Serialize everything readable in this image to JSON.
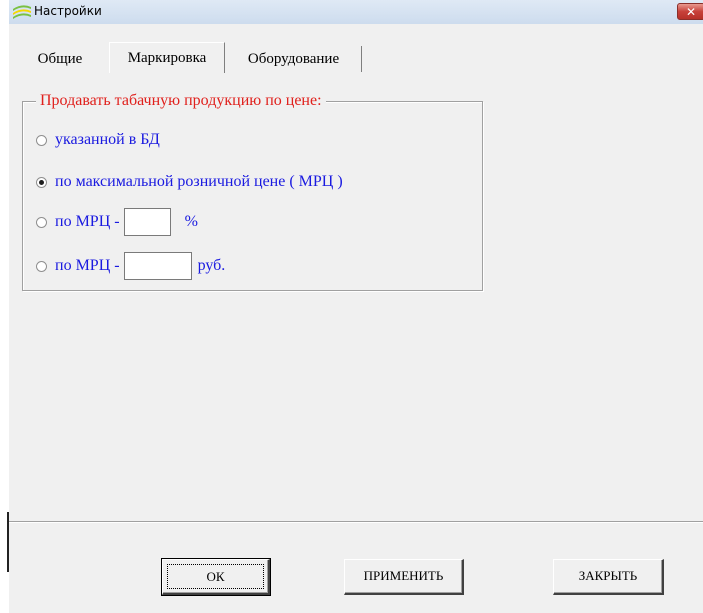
{
  "window": {
    "title": "Настройки",
    "close_glyph": "✕",
    "icon": "app-stripes-icon",
    "icon_colors": [
      "#7ac143",
      "#f5d800"
    ]
  },
  "tabs": [
    {
      "label": "Общие",
      "active": false
    },
    {
      "label": "Маркировка",
      "active": true
    },
    {
      "label": "Оборудование",
      "active": false
    }
  ],
  "price_group": {
    "title": "Продавать табачную продукцию по цене:",
    "title_color": "#e0201c",
    "label_color": "#1a1ae0",
    "options": [
      {
        "label": "указанной в БД",
        "checked": false
      },
      {
        "label": "по максимальной розничной цене ( МРЦ )",
        "checked": true
      },
      {
        "label": "по МРЦ -",
        "checked": false,
        "value": "",
        "unit": "%"
      },
      {
        "label": "по МРЦ -",
        "checked": false,
        "value": "",
        "unit": "руб."
      }
    ]
  },
  "buttons": {
    "ok": "ОК",
    "apply": "ПРИМЕНИТЬ",
    "close": "ЗАКРЫТЬ"
  }
}
